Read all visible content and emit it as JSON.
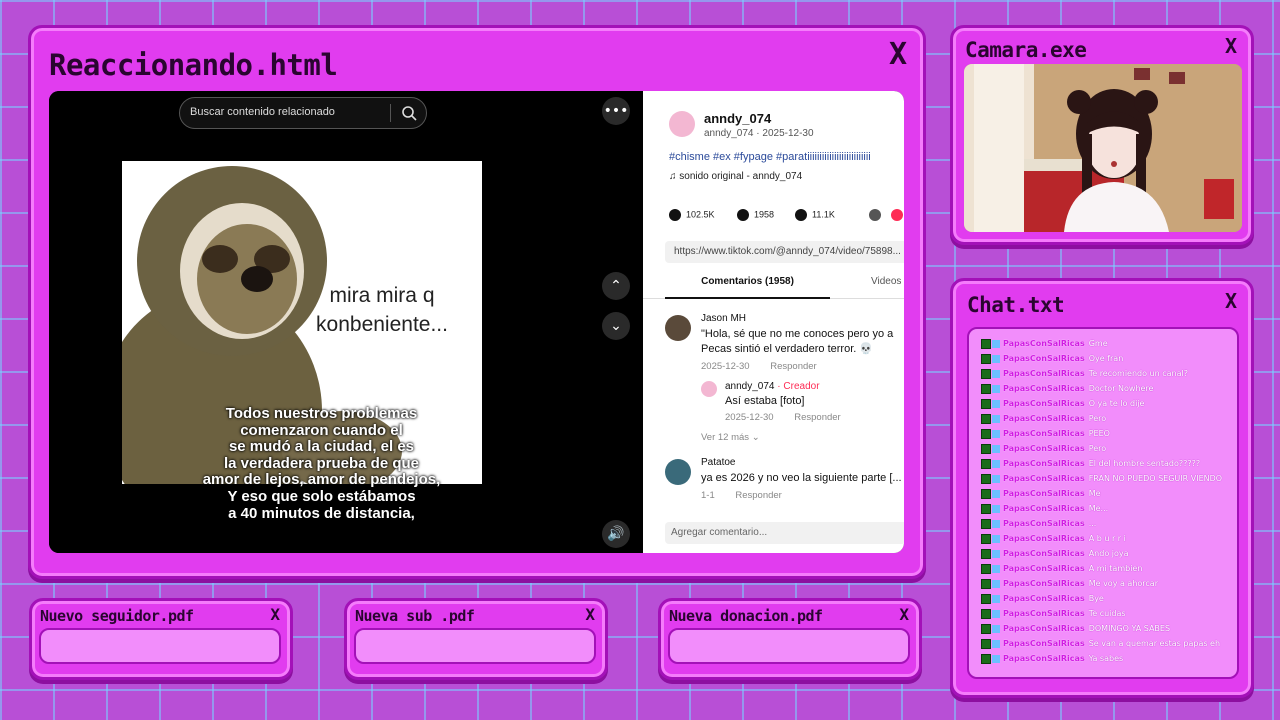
{
  "main_window": {
    "title": "Reaccionando.html",
    "close": "X",
    "search_placeholder": "Buscar contenido relacionado",
    "meme_text": [
      "mira mira q",
      "konbeniente..."
    ],
    "subtitles": [
      "Todos nuestros problemas",
      "comenzaron cuando el",
      "se mudó a la ciudad, el es",
      "la verdadera prueba de que",
      "amor de lejos, amor de pendejos,",
      "Y eso que solo estábamos",
      "a 40 minutos de distancia,"
    ],
    "post": {
      "username": "anndy_074",
      "user_line": "anndy_074 · 2025-12-30",
      "hashtags": "#chisme #ex #fypage #paratiiiiiiiiiiiiiiiiiiiiiiiiii",
      "sound": "♫  sonido original - anndy_074",
      "likes": "102.5K",
      "comments_count": "1958",
      "saves": "11.1K",
      "url": "https://www.tiktok.com/@anndy_074/video/75898...",
      "tab_comments": "Comentarios (1958)",
      "tab_videos": "Videos",
      "comments": [
        {
          "name": "Jason MH",
          "text_lines": [
            "\"Hola, sé que no me conoces pero yo a",
            "Pecas sintió el verdadero terror. 💀"
          ],
          "date": "2025-12-30",
          "reply": "Responder"
        },
        {
          "name": "Patatoe",
          "text_lines": [
            "ya es 2026 y no veo la siguiente parte [..."
          ],
          "date": "1-1",
          "reply": "Responder"
        }
      ],
      "creator_reply": {
        "name": "anndy_074",
        "tag": "Creador",
        "text": "Así estaba [foto]",
        "date": "2025-12-30",
        "reply": "Responder"
      },
      "more": "Ver 12 más",
      "add_comment": "Agregar comentario..."
    }
  },
  "camera_window": {
    "title": "Camara.exe",
    "close": "X"
  },
  "chat_window": {
    "title": "Chat.txt",
    "close": "X",
    "username": "PapasConSalRicas",
    "messages": [
      "Gme",
      "Oye fran",
      "Te recomiendo un canal?",
      "Doctor Nowhere",
      "O ya te lo dije",
      "Pero",
      "PEEO",
      "Pero",
      "El del hombre sentado?????",
      "FRAN NO PUEDO SEGUIR VIENDO",
      "Me",
      "Me...",
      "...",
      "A b u r r i",
      "Ando joya",
      "A mi tambien",
      "Me voy a ahorcar",
      "Bye",
      "Te cuidas",
      "DOMINGO YA SABES",
      "Se van a quemar estas papas eh",
      "Ya sabes"
    ]
  },
  "notifications": [
    {
      "title": "Nuevo seguidor.pdf",
      "close": "X"
    },
    {
      "title": "Nueva sub .pdf",
      "close": "X"
    },
    {
      "title": "Nueva donacion.pdf",
      "close": "X"
    }
  ],
  "colors": {
    "window": "#e13cef",
    "border": "#a311b8",
    "background": "#b84fd6",
    "grid": "#78d2ff"
  }
}
